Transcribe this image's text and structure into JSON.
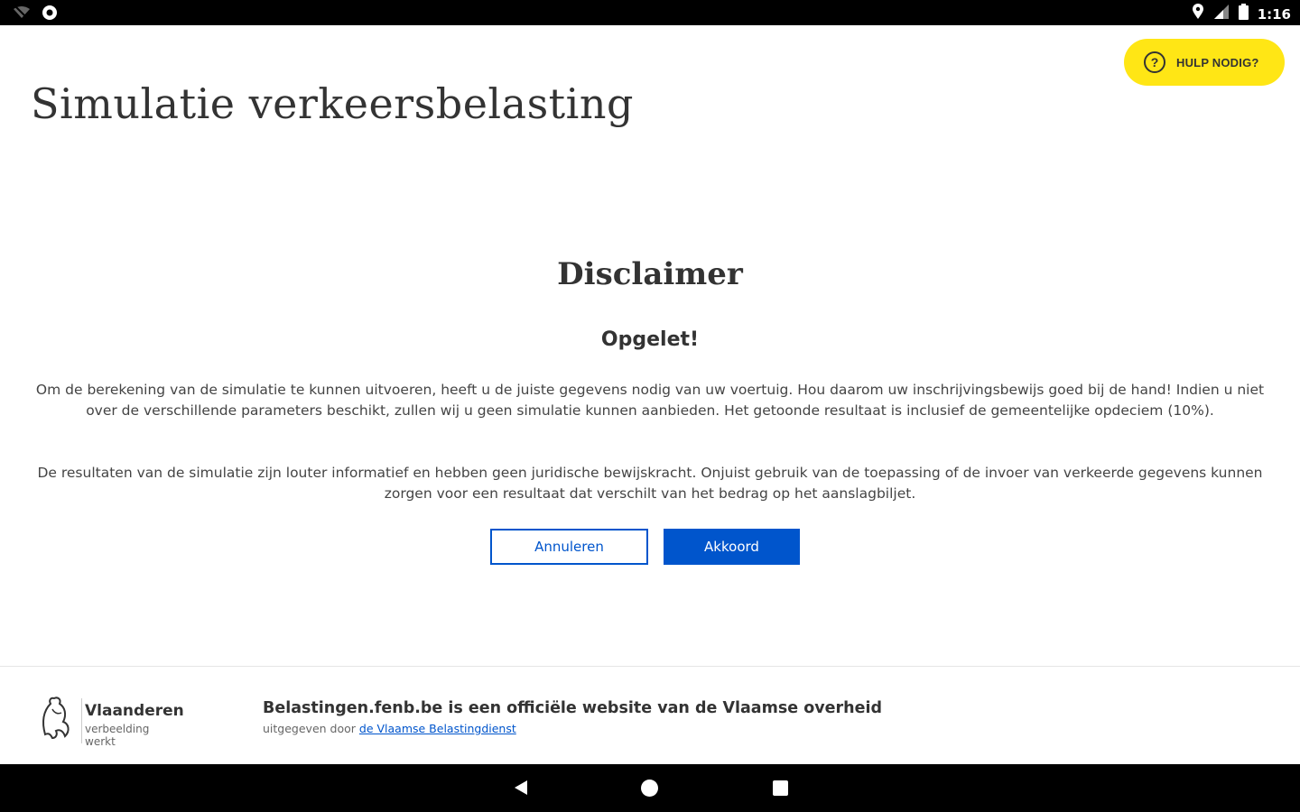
{
  "status_bar": {
    "time": "1:16",
    "icons_left": [
      "wifi-off-icon",
      "settings-circle-icon"
    ],
    "icons_right": [
      "location-icon",
      "signal-icon",
      "battery-icon"
    ]
  },
  "help_button": {
    "label": "HULP NODIG?",
    "icon": "question-circle-icon",
    "color": "#ffe615"
  },
  "page": {
    "title": "Simulatie verkeersbelasting"
  },
  "dialog": {
    "title": "Disclaimer",
    "warning": "Opgelet!",
    "paragraph1": "Om de berekening van de simulatie te kunnen uitvoeren, heeft u de juiste gegevens nodig van uw voertuig. Hou daarom uw inschrijvingsbewijs goed bij de hand! Indien u niet over de verschillende parameters beschikt, zullen wij u geen simulatie kunnen aanbieden. Het getoonde resultaat is inclusief de gemeentelijke opdeciem (10%).",
    "paragraph2": "De resultaten van de simulatie zijn louter informatief en hebben geen juridische bewijskracht. Onjuist gebruik van de toepassing of de invoer van verkeerde gegevens kunnen zorgen voor een resultaat dat verschilt van het bedrag op het aanslagbiljet.",
    "cancel_label": "Annuleren",
    "accept_label": "Akkoord",
    "accent_color": "#0055cc"
  },
  "footer": {
    "brand": "Vlaanderen",
    "tagline": "verbeelding werkt",
    "official_text": "Belastingen.fenb.be is een officiële website van de Vlaamse overheid",
    "byline_prefix": "uitgegeven door",
    "byline_link": "de Vlaamse Belastingdienst"
  },
  "nav_bar": {
    "buttons": [
      "back-icon",
      "home-icon",
      "recents-icon"
    ]
  }
}
